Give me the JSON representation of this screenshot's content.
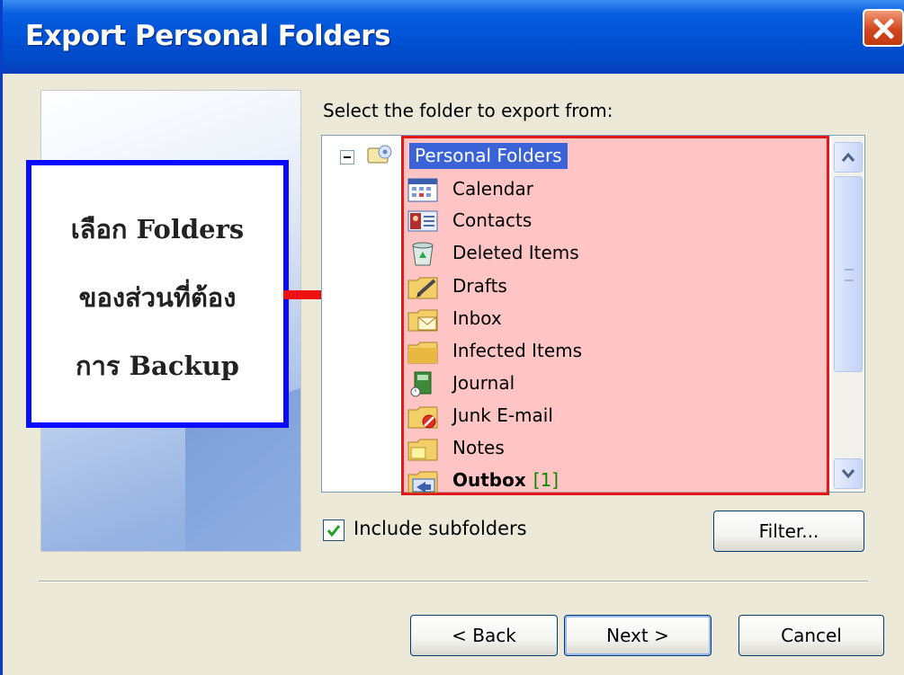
{
  "window": {
    "title": "Export Personal Folders"
  },
  "callout": {
    "lines": [
      "เลือก Folders",
      "ของส่วนที่ต้อง",
      "การ Backup"
    ]
  },
  "prompt": "Select the folder to export from:",
  "tree": {
    "root": {
      "label": "Personal Folders",
      "icon": "personal-folders-icon"
    },
    "items": [
      {
        "label": "Calendar",
        "icon": "calendar-icon"
      },
      {
        "label": "Contacts",
        "icon": "contacts-icon"
      },
      {
        "label": "Deleted Items",
        "icon": "deleted-items-icon"
      },
      {
        "label": "Drafts",
        "icon": "drafts-icon"
      },
      {
        "label": "Inbox",
        "icon": "inbox-icon"
      },
      {
        "label": "Infected Items",
        "icon": "folder-icon"
      },
      {
        "label": "Journal",
        "icon": "journal-icon"
      },
      {
        "label": "Junk E-mail",
        "icon": "junk-email-icon"
      },
      {
        "label": "Notes",
        "icon": "notes-icon"
      },
      {
        "label": "Outbox",
        "count": "[1]",
        "icon": "outbox-icon"
      }
    ]
  },
  "options": {
    "include_subfolders_label": "Include subfolders",
    "include_subfolders_checked": true
  },
  "buttons": {
    "filter": "Filter...",
    "back": "< Back",
    "next": "Next >",
    "cancel": "Cancel"
  },
  "colors": {
    "titlebar": "#0052d6",
    "highlight_border": "#e01818",
    "callout_border": "#0a0aff",
    "selection": "#3a63d8"
  }
}
